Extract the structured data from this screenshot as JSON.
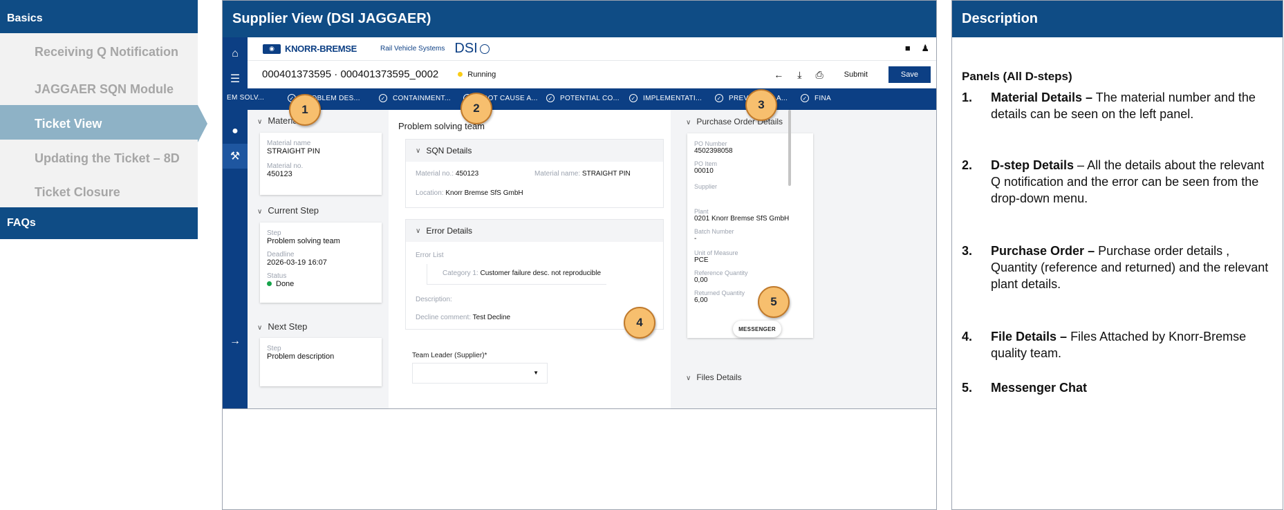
{
  "nav": {
    "basics": "Basics",
    "items": [
      "Receiving Q Notification",
      "JAGGAER SQN Module",
      "Ticket View",
      "Updating the Ticket – 8D",
      "Ticket Closure"
    ],
    "faqs": "FAQs"
  },
  "main": {
    "title": "Supplier View (DSI JAGGAER)",
    "logo": {
      "brand": "KNORR-BREMSE",
      "subtitle": "Rail Vehicle Systems",
      "dsi": "DSI"
    },
    "ticket": {
      "number": "000401373595 · 000401373595_0002",
      "status": "Running",
      "submit": "Submit",
      "save": "Save"
    },
    "steps": [
      "EM SOLV...",
      "PROBLEM DES...",
      "CONTAINMENT...",
      "ROOT CAUSE A...",
      "POTENTIAL CO...",
      "IMPLEMENTATI...",
      "PREVENTIVE A...",
      "FINA"
    ],
    "material": {
      "title": "Material",
      "name_label": "Material name",
      "name": "STRAIGHT PIN",
      "no_label": "Material no.",
      "no": "450123"
    },
    "current_step": {
      "title": "Current Step",
      "step_label": "Step",
      "step": "Problem solving team",
      "deadline_label": "Deadline",
      "deadline": "2026-03-19 16:07",
      "status_label": "Status",
      "status": "Done"
    },
    "next_step": {
      "title": "Next Step",
      "step_label": "Step",
      "step": "Problem description"
    },
    "center": {
      "title": "Problem solving team",
      "sqn_title": "SQN Details",
      "material_no_label": "Material no.:",
      "material_no": "450123",
      "material_name_label": "Material name:",
      "material_name": "STRAIGHT PIN",
      "location_label": "Location:",
      "location": "Knorr Bremse SfS GmbH",
      "error_title": "Error Details",
      "error_list_label": "Error List",
      "category_label": "Category 1:",
      "category": "Customer failure desc. not reproducible",
      "description_label": "Description:",
      "decline_label": "Decline comment:",
      "decline": "Test Decline",
      "team_leader_label": "Team Leader (Supplier)*"
    },
    "po": {
      "title": "Purchase Order Details",
      "po_number_label": "PO Number",
      "po_number": "4502398058",
      "po_item_label": "PO Item",
      "po_item": "00010",
      "supplier_label": "Supplier",
      "plant_label": "Plant",
      "plant": "0201 Knorr Bremse SfS GmbH",
      "batch_label": "Batch Number",
      "batch": "-",
      "uom_label": "Unit of Measure",
      "uom": "PCE",
      "ref_qty_label": "Reference Quantity",
      "ref_qty": "0,00",
      "ret_qty_label": "Returned Quantity",
      "ret_qty": "6,00",
      "files_title": "Files Details",
      "messenger": "MESSENGER"
    },
    "callouts": [
      "1",
      "2",
      "3",
      "4",
      "5"
    ]
  },
  "desc": {
    "title": "Description",
    "heading": "Panels (All D-steps)",
    "items": [
      {
        "num": "1.",
        "title": "Material Details –",
        "text": " The material number and the details can be seen on the left panel."
      },
      {
        "num": "2.",
        "title": "D-step Details",
        "text": " – All the details about the relevant Q notification and the error can be seen from the drop-down menu."
      },
      {
        "num": "3.",
        "title": "Purchase Order –",
        "text": " Purchase order details , Quantity (reference and returned) and the relevant plant details."
      },
      {
        "num": "4.",
        "title": "File Details –",
        "text": " Files Attached by Knorr-Bremse quality team."
      },
      {
        "num": "5.",
        "title": "Messenger Chat",
        "text": ""
      }
    ]
  },
  "colors": {
    "header_blue": "#0f4c85",
    "app_blue": "#0c3f84",
    "active_nav": "#8eb2c6",
    "callout": "#f7bf6e"
  }
}
